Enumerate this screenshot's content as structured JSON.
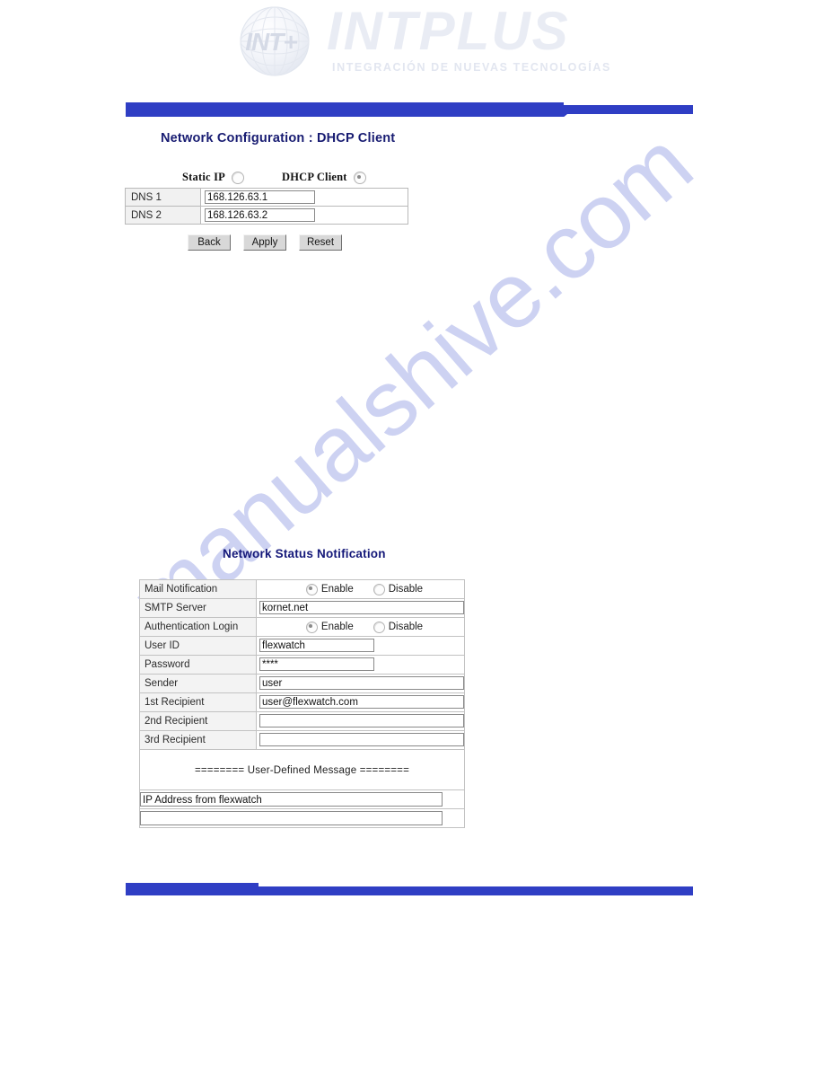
{
  "branding": {
    "globe_mark": "INT+",
    "wordmark": "INTPLUS",
    "tagline": "INTEGRACIÓN  DE  NUEVAS  TECNOLOGÍAS",
    "rule_color": "#2f3ec4",
    "heading_color": "#181c72"
  },
  "watermark": {
    "text": "manualshive.com",
    "color": "#cdd2f2"
  },
  "network_config": {
    "title": "Network Configuration : DHCP Client",
    "mode_options": [
      {
        "label": "Static IP",
        "checked": false
      },
      {
        "label": "DHCP Client",
        "checked": true
      }
    ],
    "rows": [
      {
        "key": "DNS 1",
        "value": "168.126.63.1"
      },
      {
        "key": "DNS 2",
        "value": "168.126.63.2"
      }
    ],
    "buttons": [
      {
        "label": "Back"
      },
      {
        "label": "Apply"
      },
      {
        "label": "Reset"
      }
    ]
  },
  "notification": {
    "title": "Network Status Notification",
    "rows": [
      {
        "key": "Mail Notification",
        "type": "radio",
        "options": [
          {
            "label": "Enable",
            "checked": true
          },
          {
            "label": "Disable",
            "checked": false
          }
        ]
      },
      {
        "key": "SMTP Server",
        "type": "text",
        "value": "kornet.net",
        "width": "full"
      },
      {
        "key": "Authentication Login",
        "type": "radio",
        "options": [
          {
            "label": "Enable",
            "checked": true
          },
          {
            "label": "Disable",
            "checked": false
          }
        ]
      },
      {
        "key": "User ID",
        "type": "text",
        "value": "flexwatch",
        "width": "mid"
      },
      {
        "key": "Password",
        "type": "text",
        "value": "****",
        "width": "mid"
      },
      {
        "key": "Sender",
        "type": "text",
        "value": "user",
        "width": "full"
      },
      {
        "key": "1st Recipient",
        "type": "text",
        "value": "user@flexwatch.com",
        "width": "full"
      },
      {
        "key": "2nd Recipient",
        "type": "text",
        "value": "",
        "width": "full"
      },
      {
        "key": "3rd Recipient",
        "type": "text",
        "value": "",
        "width": "full"
      }
    ],
    "user_defined_message_header": "======== User-Defined Message ========",
    "message_lines": [
      {
        "value": "IP Address from flexwatch"
      },
      {
        "value": ""
      }
    ]
  }
}
